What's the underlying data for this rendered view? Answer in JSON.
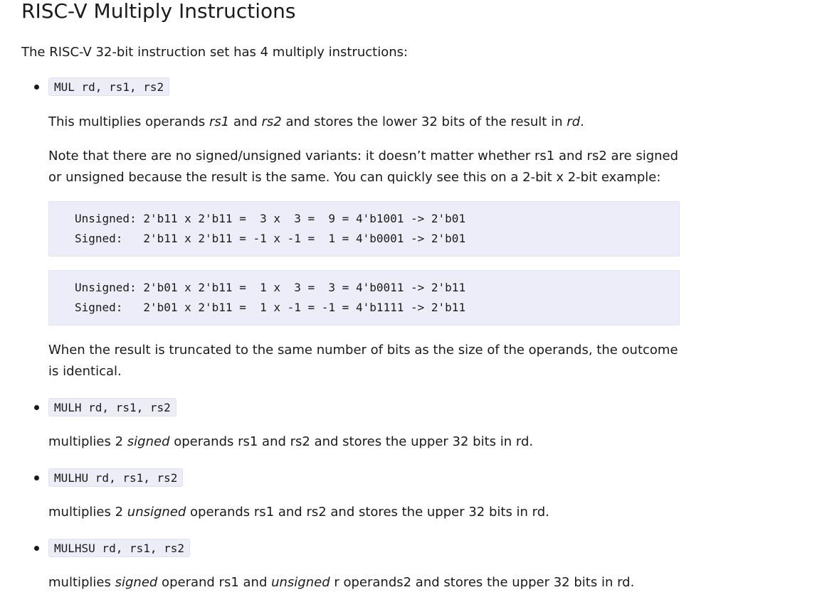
{
  "title": "RISC-V Multiply Instructions",
  "intro": "The RISC-V 32-bit instruction set has 4 multiply instructions:",
  "mul": {
    "code": "MUL rd, rs1, rs2",
    "desc": {
      "t1": "This multiplies operands ",
      "rs1": "rs1",
      "t2": " and ",
      "rs2": "rs2",
      "t3": " and stores the lower 32 bits of the result in ",
      "rd": "rd",
      "t4": "."
    },
    "note": "Note that there are no signed/unsigned variants: it doesn’t matter whether rs1 and rs2 are signed or unsigned because the result is the same. You can quickly see this on a 2-bit x 2-bit example:",
    "example1": {
      "line1": "Unsigned: 2'b11 x 2'b11 =  3 x  3 =  9 = 4'b1001 -> 2'b01",
      "line2": "Signed:   2'b11 x 2'b11 = -1 x -1 =  1 = 4'b0001 -> 2'b01"
    },
    "example2": {
      "line1": "Unsigned: 2'b01 x 2'b11 =  1 x  3 =  3 = 4'b0011 -> 2'b11",
      "line2": "Signed:   2'b01 x 2'b11 =  1 x -1 = -1 = 4'b1111 -> 2'b11"
    },
    "conclusion": "When the result is truncated to the same number of bits as the size of the operands, the outcome is identical."
  },
  "mulh": {
    "code": "MULH rd, rs1, rs2",
    "t1": "multiplies 2 ",
    "em": "signed",
    "t2": " operands rs1 and rs2 and stores the upper 32 bits in rd."
  },
  "mulhu": {
    "code": "MULHU rd, rs1, rs2",
    "t1": "multiplies 2 ",
    "em": "unsigned",
    "t2": " operands rs1 and rs2 and stores the upper 32 bits in rd."
  },
  "mulhsu": {
    "code": "MULHSU rd, rs1, rs2",
    "t1": "multiplies ",
    "em1": "signed",
    "t2": " operand rs1 and ",
    "em2": "unsigned",
    "t3": " r operands2 and stores the upper 32 bits in rd."
  }
}
